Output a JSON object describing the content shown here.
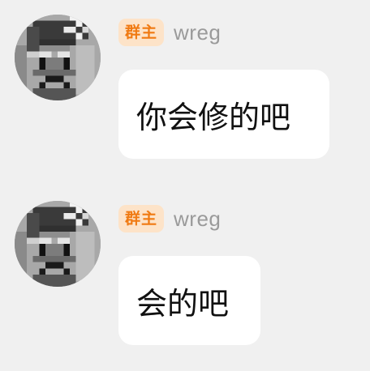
{
  "messages": [
    {
      "badge": "群主",
      "nickname": "wreg",
      "text": "你会修的吧",
      "avatar_icon": "pixel-face-avatar"
    },
    {
      "badge": "群主",
      "nickname": "wreg",
      "text": "会的吧",
      "avatar_icon": "pixel-face-avatar"
    }
  ],
  "colors": {
    "background": "#f0f0f0",
    "bubble": "#ffffff",
    "badge_bg": "#fde3c8",
    "badge_text": "#f07a12",
    "nickname": "#9a9a9a"
  }
}
